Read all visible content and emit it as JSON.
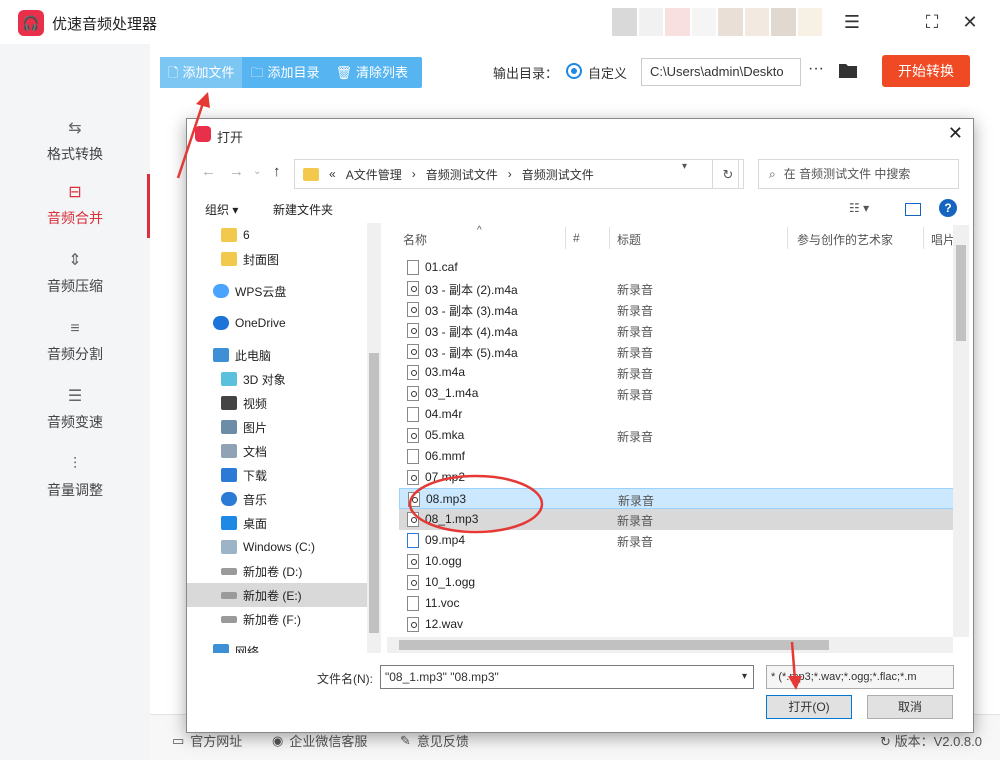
{
  "app": {
    "title": "优速音频处理器",
    "logo_icon": "headphones-icon",
    "window_controls": [
      "menu-icon",
      "maximize-icon",
      "close-icon"
    ]
  },
  "sidebar": {
    "items": [
      {
        "label": "格式转换",
        "icon": "convert-icon",
        "active": false
      },
      {
        "label": "音频合并",
        "icon": "merge-icon",
        "active": true
      },
      {
        "label": "音频压缩",
        "icon": "compress-icon",
        "active": false
      },
      {
        "label": "音频分割",
        "icon": "split-icon",
        "active": false
      },
      {
        "label": "音频变速",
        "icon": "speed-icon",
        "active": false
      },
      {
        "label": "音量调整",
        "icon": "volume-icon",
        "active": false
      }
    ]
  },
  "toolbar": {
    "add_file": "添加文件",
    "add_dir": "添加目录",
    "clear_list": "清除列表",
    "output_label": "输出目录：",
    "output_mode": "自定义",
    "output_path": "C:\\Users\\admin\\Deskto",
    "more": "···",
    "start": "开始转换"
  },
  "footer": {
    "website": "官方网址",
    "wechat": "企业微信客服",
    "feedback": "意见反馈",
    "version": "版本：V2.0.8.0"
  },
  "dialog": {
    "title": "打开",
    "breadcrumb": [
      "«",
      "A文件管理",
      "›",
      "音频测试文件",
      "›",
      "音频测试文件"
    ],
    "search_placeholder": "在 音频测试文件 中搜索",
    "organize": "组织 ▾",
    "new_folder": "新建文件夹",
    "tree": [
      {
        "label": "6",
        "icon": "folder-icon"
      },
      {
        "label": "封面图",
        "icon": "folder-icon"
      },
      {
        "label": "WPS云盘",
        "icon": "cloud-icon"
      },
      {
        "label": "OneDrive",
        "icon": "onedrive-icon"
      },
      {
        "label": "此电脑",
        "icon": "computer-icon"
      },
      {
        "label": "3D 对象",
        "icon": "3d-icon"
      },
      {
        "label": "视频",
        "icon": "video-icon"
      },
      {
        "label": "图片",
        "icon": "picture-icon"
      },
      {
        "label": "文档",
        "icon": "document-icon"
      },
      {
        "label": "下载",
        "icon": "download-icon"
      },
      {
        "label": "音乐",
        "icon": "music-icon"
      },
      {
        "label": "桌面",
        "icon": "desktop-icon"
      },
      {
        "label": "Windows (C:)",
        "icon": "drive-icon"
      },
      {
        "label": "新加卷 (D:)",
        "icon": "drive-icon"
      },
      {
        "label": "新加卷 (E:)",
        "icon": "drive-icon",
        "selected": true
      },
      {
        "label": "新加卷 (F:)",
        "icon": "drive-icon"
      },
      {
        "label": "网络",
        "icon": "network-icon"
      }
    ],
    "columns": [
      "名称",
      "#",
      "标题",
      "参与创作的艺术家",
      "唱片"
    ],
    "files": [
      {
        "name": "01.caf",
        "title": "",
        "type": "doc"
      },
      {
        "name": "03 - 副本 (2).m4a",
        "title": "新录音",
        "type": "audio"
      },
      {
        "name": "03 - 副本 (3).m4a",
        "title": "新录音",
        "type": "audio"
      },
      {
        "name": "03 - 副本 (4).m4a",
        "title": "新录音",
        "type": "audio"
      },
      {
        "name": "03 - 副本 (5).m4a",
        "title": "新录音",
        "type": "audio"
      },
      {
        "name": "03.m4a",
        "title": "新录音",
        "type": "audio"
      },
      {
        "name": "03_1.m4a",
        "title": "新录音",
        "type": "audio"
      },
      {
        "name": "04.m4r",
        "title": "",
        "type": "doc"
      },
      {
        "name": "05.mka",
        "title": "新录音",
        "type": "audio"
      },
      {
        "name": "06.mmf",
        "title": "",
        "type": "doc"
      },
      {
        "name": "07.mp2",
        "title": "",
        "type": "audio"
      },
      {
        "name": "08.mp3",
        "title": "新录音",
        "type": "audio",
        "selected": "blue"
      },
      {
        "name": "08_1.mp3",
        "title": "新录音",
        "type": "audio",
        "selected": "grey"
      },
      {
        "name": "09.mp4",
        "title": "新录音",
        "type": "video"
      },
      {
        "name": "10.ogg",
        "title": "",
        "type": "audio"
      },
      {
        "name": "10_1.ogg",
        "title": "",
        "type": "audio"
      },
      {
        "name": "11.voc",
        "title": "",
        "type": "doc"
      },
      {
        "name": "12.wav",
        "title": "",
        "type": "audio"
      }
    ],
    "filename_label": "文件名(N):",
    "filename_value": "\"08_1.mp3\" \"08.mp3\"",
    "filetype_value": "* (*.mp3;*.wav;*.ogg;*.flac;*.m",
    "open_button": "打开(O)",
    "cancel_button": "取消"
  },
  "colors": {
    "accent_red": "#d9303b",
    "start_button": "#f04a25",
    "toolbar_blue": "#56b4f1",
    "selection_blue": "#cce8ff"
  }
}
